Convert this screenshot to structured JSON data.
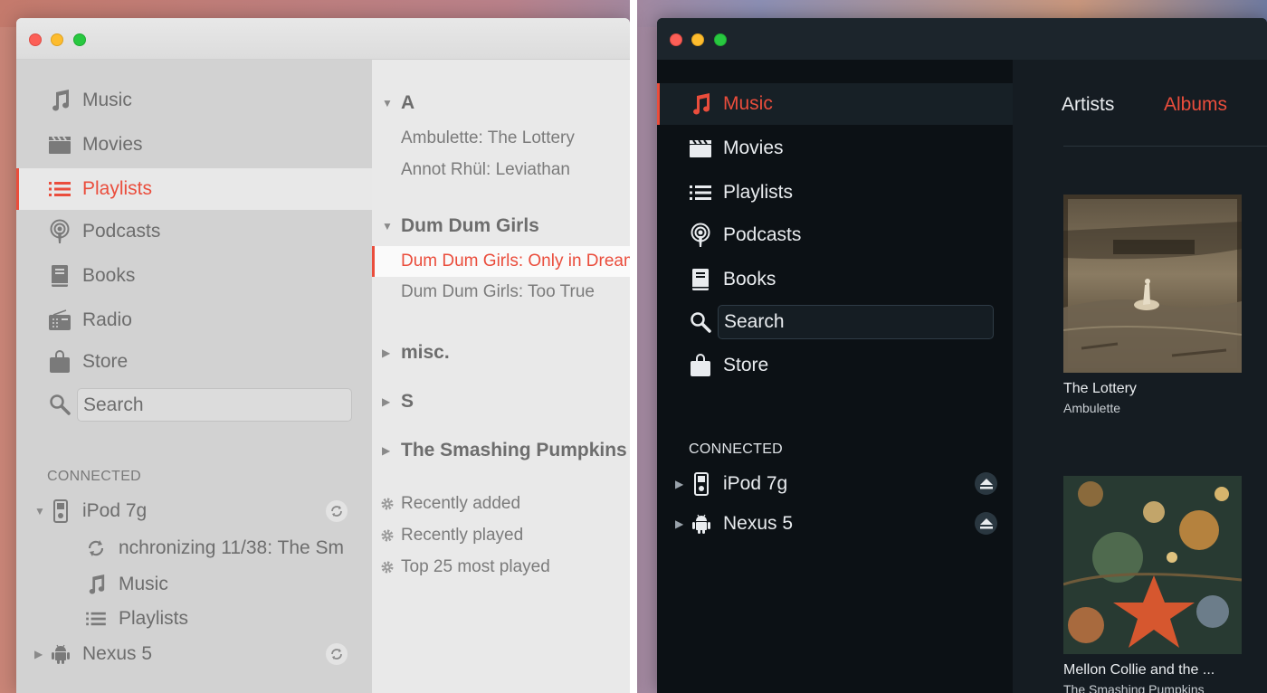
{
  "light": {
    "nav": [
      {
        "label": "Music",
        "icon": "music-note-icon"
      },
      {
        "label": "Movies",
        "icon": "clapperboard-icon"
      },
      {
        "label": "Playlists",
        "icon": "list-icon"
      },
      {
        "label": "Podcasts",
        "icon": "podcast-icon"
      },
      {
        "label": "Books",
        "icon": "book-icon"
      },
      {
        "label": "Radio",
        "icon": "radio-icon"
      },
      {
        "label": "Store",
        "icon": "shopping-bag-icon"
      }
    ],
    "active_nav": "Playlists",
    "search": {
      "placeholder": "Search"
    },
    "connected_label": "CONNECTED",
    "devices": [
      {
        "name": "iPod 7g",
        "expanded": true,
        "sync_status": "nchronizing 11/38: The Sm",
        "subitems": [
          "Music",
          "Playlists"
        ]
      },
      {
        "name": "Nexus 5",
        "expanded": false
      }
    ],
    "groups": [
      {
        "name": "A",
        "expanded": true,
        "items": [
          "Ambulette: The Lottery",
          "Annot Rhül: Leviathan"
        ]
      },
      {
        "name": "Dum Dum Girls",
        "expanded": true,
        "items": [
          "Dum Dum Girls: Only in Dreams",
          "Dum Dum Girls: Too True"
        ]
      },
      {
        "name": "misc.",
        "expanded": false
      },
      {
        "name": "S",
        "expanded": false
      },
      {
        "name": "The Smashing Pumpkins",
        "expanded": false
      }
    ],
    "smart_playlists": [
      "Recently added",
      "Recently played",
      "Top 25 most played"
    ]
  },
  "dark": {
    "nav": [
      {
        "label": "Music",
        "icon": "music-note-icon"
      },
      {
        "label": "Movies",
        "icon": "clapperboard-icon"
      },
      {
        "label": "Playlists",
        "icon": "list-icon"
      },
      {
        "label": "Podcasts",
        "icon": "podcast-icon"
      },
      {
        "label": "Books",
        "icon": "book-icon"
      },
      {
        "label": "Store",
        "icon": "shopping-bag-icon"
      }
    ],
    "active_nav": "Music",
    "search": {
      "value": "Search"
    },
    "connected_label": "CONNECTED",
    "devices": [
      {
        "name": "iPod 7g",
        "icon": "ipod-icon"
      },
      {
        "name": "Nexus 5",
        "icon": "android-icon"
      }
    ],
    "tabs": [
      "Artists",
      "Albums"
    ],
    "active_tab": "Albums",
    "albums": [
      {
        "title": "The Lottery",
        "artist": "Ambulette"
      },
      {
        "title": "Mellon Collie and the ...",
        "artist": "The Smashing Pumpkins"
      }
    ]
  },
  "colors": {
    "accent": "#ea4d3c",
    "light_sidebar": "#d2d2d2",
    "dark_sidebar": "#0c1115"
  }
}
